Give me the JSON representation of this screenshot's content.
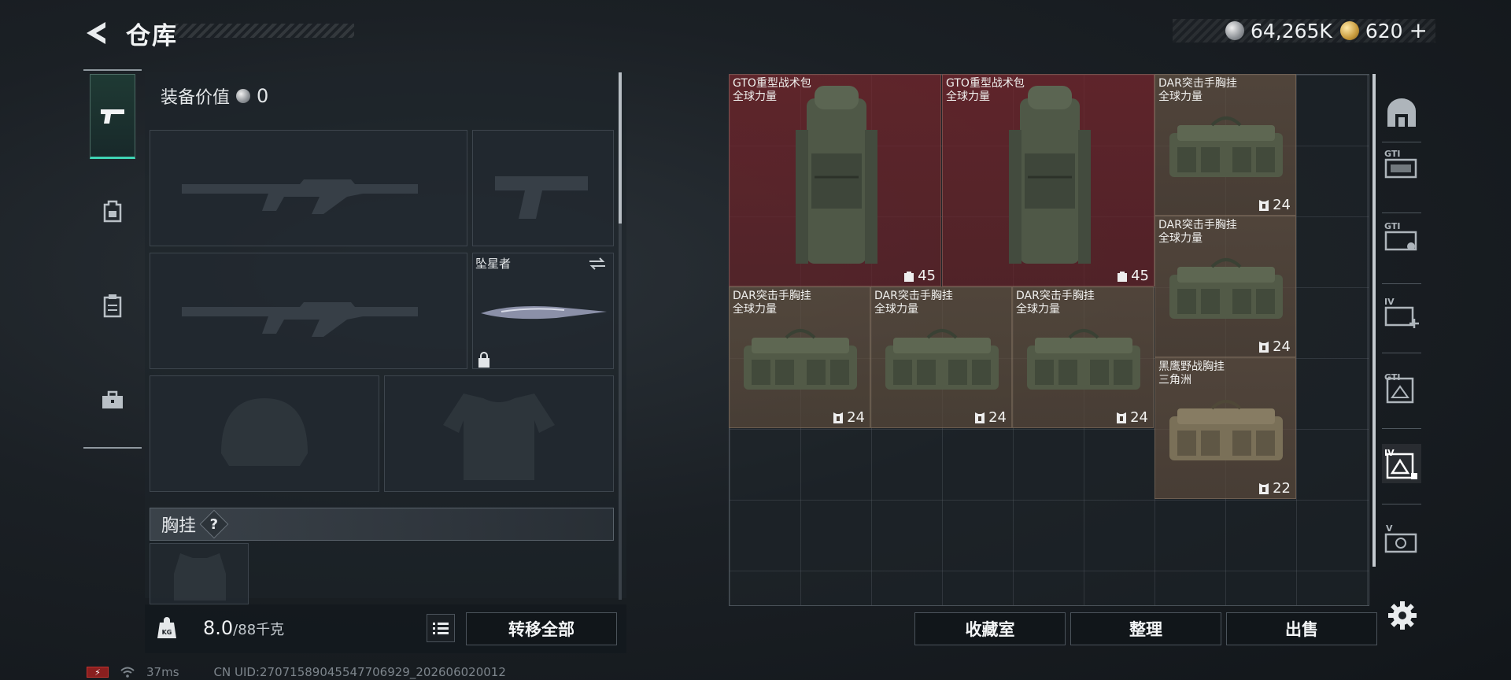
{
  "header": {
    "title": "仓库",
    "currencies": [
      {
        "icon": "silver-coin-icon",
        "value": "64,265K"
      },
      {
        "icon": "gold-coin-icon",
        "value": "620"
      }
    ],
    "plus_label": "+"
  },
  "tabs": [
    {
      "icon": "pistol-icon",
      "active": true
    },
    {
      "icon": "backpack-icon",
      "active": false
    },
    {
      "icon": "clipboard-icon",
      "active": false
    },
    {
      "icon": "toolbox-icon",
      "active": false
    }
  ],
  "equipment": {
    "value_label": "装备价值",
    "value": "0",
    "melee_name": "坠星者",
    "chest_rig_label": "胸挂",
    "help_label": "?"
  },
  "bottom_left": {
    "weight_current": "8.0",
    "weight_max": "/88千克",
    "weight_icon_label": "KG",
    "transfer_all": "转移全部"
  },
  "items": [
    {
      "name": "GTO重型战术包",
      "subtitle": "全球力量",
      "count": "45",
      "count_icon": "backpack-count-icon",
      "color": "red"
    },
    {
      "name": "GTO重型战术包",
      "subtitle": "全球力量",
      "count": "45",
      "count_icon": "backpack-count-icon",
      "color": "red"
    },
    {
      "name": "DAR突击手胸挂",
      "subtitle": "全球力量",
      "count": "24",
      "count_icon": "vest-count-icon",
      "color": "brown"
    },
    {
      "name": "DAR突击手胸挂",
      "subtitle": "全球力量",
      "count": "24",
      "count_icon": "vest-count-icon",
      "color": "brown"
    },
    {
      "name": "DAR突击手胸挂",
      "subtitle": "全球力量",
      "count": "24",
      "count_icon": "vest-count-icon",
      "color": "brown"
    },
    {
      "name": "DAR突击手胸挂",
      "subtitle": "全球力量",
      "count": "24",
      "count_icon": "vest-count-icon",
      "color": "brown"
    },
    {
      "name": "DAR突击手胸挂",
      "subtitle": "全球力量",
      "count": "24",
      "count_icon": "vest-count-icon",
      "color": "brown"
    },
    {
      "name": "黑鹰野战胸挂",
      "subtitle": "三角洲",
      "count": "22",
      "count_icon": "vest-count-icon",
      "color": "brown"
    }
  ],
  "side_tabs": [
    {
      "icon": "arch-icon",
      "label": ""
    },
    {
      "icon": "container-gti-icon",
      "label": "GTI"
    },
    {
      "icon": "container-gti-icon",
      "label": "GTI"
    },
    {
      "icon": "container-iv-add-icon",
      "label": "IV"
    },
    {
      "icon": "container-gti-icon",
      "label": "GTI"
    },
    {
      "icon": "container-iv-icon",
      "label": "IV",
      "active": true
    },
    {
      "icon": "container-v-icon",
      "label": "V"
    }
  ],
  "actions": {
    "collection_room": "收藏室",
    "organize": "整理",
    "sell": "出售"
  },
  "status": {
    "ping": "37ms",
    "uid": "CN UID:270715890455477069​29_202606020012"
  },
  "colors": {
    "accent": "#3fd4b4",
    "item_red": "#782630",
    "item_brown": "#645242"
  }
}
